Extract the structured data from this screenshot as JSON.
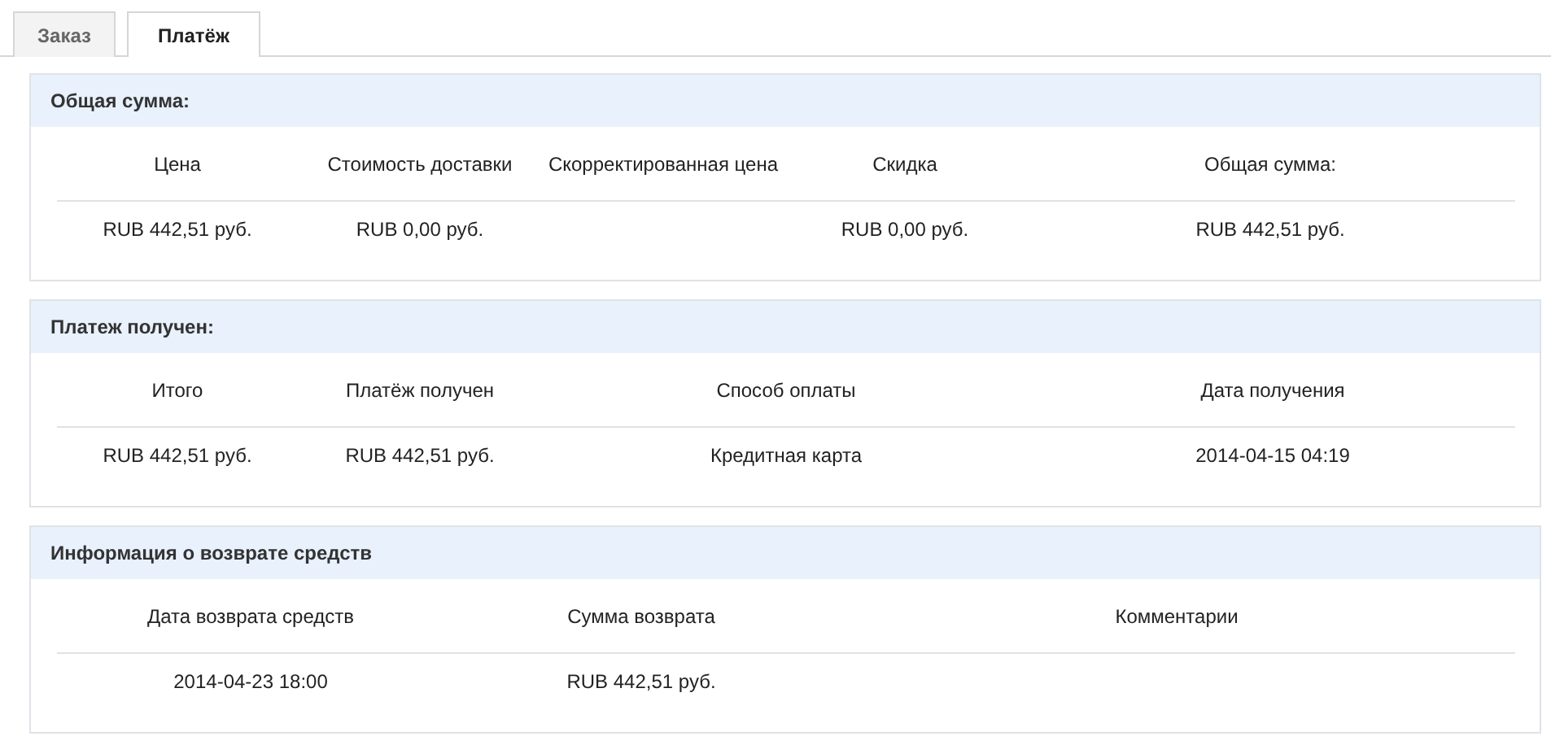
{
  "tabs": [
    {
      "label": "Заказ",
      "selected": false
    },
    {
      "label": "Платёж",
      "selected": true
    }
  ],
  "panels": [
    {
      "title": "Общая сумма:",
      "columns": [
        "Цена",
        "Стоимость доставки",
        "Скорректированная цена",
        "Скидка",
        "Общая сумма:"
      ],
      "rows": [
        [
          "RUB 442,51 руб.",
          "RUB 0,00 руб.",
          "",
          "RUB 0,00 руб.",
          "RUB 442,51 руб."
        ]
      ]
    },
    {
      "title": "Платеж получен:",
      "columns": [
        "Итого",
        "Платёж получен",
        "Способ оплаты",
        "Дата получения"
      ],
      "rows": [
        [
          "RUB 442,51 руб.",
          "RUB 442,51 руб.",
          "Кредитная карта",
          "2014-04-15 04:19"
        ]
      ]
    },
    {
      "title": "Информация о возврате средств",
      "columns": [
        "Дата возврата средств",
        "Сумма возврата",
        "Комментарии"
      ],
      "rows": [
        [
          "2014-04-23 18:00",
          "RUB 442,51 руб.",
          ""
        ]
      ]
    }
  ]
}
